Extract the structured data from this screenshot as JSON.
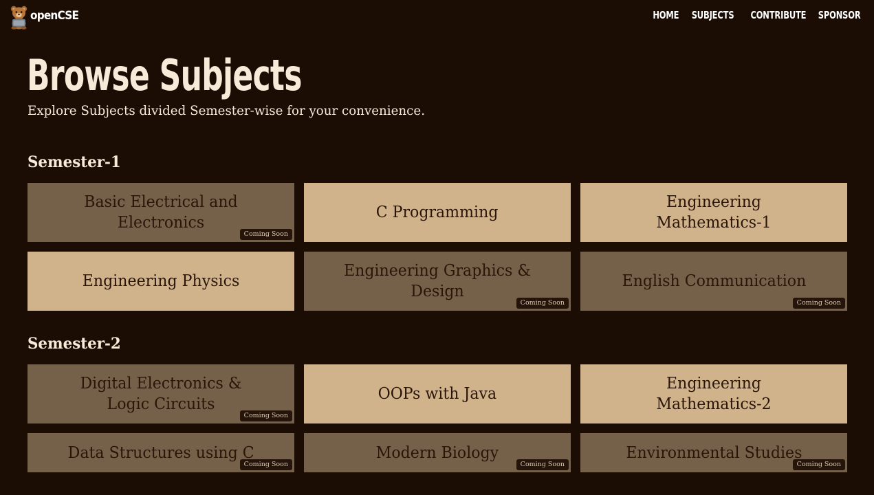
{
  "brand": {
    "name": "openCSE",
    "logo_icon": "teddy-bear-icon"
  },
  "nav": {
    "links": [
      "HOME",
      "SUBJECTS",
      "CONTRIBUTE",
      "SPONSOR"
    ]
  },
  "page": {
    "title": "Browse Subjects",
    "subtitle": "Explore Subjects divided Semester-wise for your convenience."
  },
  "colors": {
    "background": "#1b0d04",
    "card_available": "#d1b38b",
    "card_coming_soon": "#756049",
    "text_light": "#f6ead8",
    "text_dark": "#2a1609"
  },
  "badge_label": "Coming Soon",
  "semesters": [
    {
      "title": "Semester-1",
      "subjects": [
        {
          "name": "Basic Electrical and Electronics",
          "coming_soon": true
        },
        {
          "name": "C Programming",
          "coming_soon": false
        },
        {
          "name": "Engineering Mathematics-1",
          "coming_soon": false
        },
        {
          "name": "Engineering Physics",
          "coming_soon": false
        },
        {
          "name": "Engineering Graphics & Design",
          "coming_soon": true
        },
        {
          "name": "English Communication",
          "coming_soon": true
        }
      ]
    },
    {
      "title": "Semester-2",
      "subjects": [
        {
          "name": "Digital Electronics & Logic Circuits",
          "coming_soon": true
        },
        {
          "name": "OOPs with Java",
          "coming_soon": false
        },
        {
          "name": "Engineering Mathematics-2",
          "coming_soon": false
        },
        {
          "name": "Data Structures using C",
          "coming_soon": true
        },
        {
          "name": "Modern Biology",
          "coming_soon": true
        },
        {
          "name": "Environmental Studies",
          "coming_soon": true
        }
      ]
    }
  ]
}
